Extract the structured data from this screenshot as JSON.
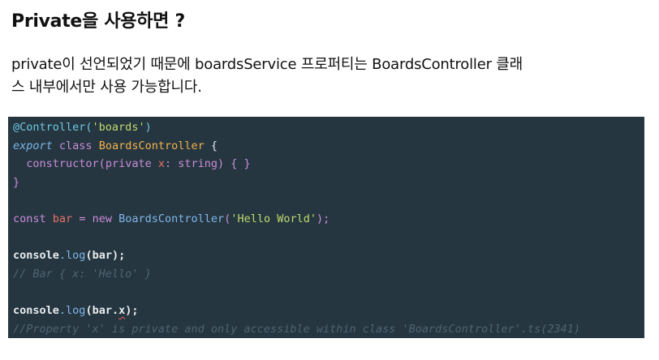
{
  "heading": "Private을 사용하면 ?",
  "paragraph": {
    "line1": "private이 선언되었기 때문에 boardsService 프로퍼티는 BoardsController 클래",
    "line2": "스 내부에서만 사용 가능합니다."
  },
  "code": {
    "l1": {
      "decorator": "@Controller(",
      "arg": "'boards'",
      "close": ")"
    },
    "l2": {
      "export": "export",
      "class": "class",
      "name": "BoardsController",
      "brace": "{"
    },
    "l3": {
      "ctor": "constructor",
      "open": "(",
      "private": "private",
      "param": "x",
      "type": ": string",
      "rest": ") { }"
    },
    "l4": {
      "brace": "}"
    },
    "l5": {
      "const": "const",
      "var": "bar",
      "eq": "=",
      "new": "new",
      "cls": "BoardsController",
      "open": "(",
      "str": "'Hello World'",
      "close": ");"
    },
    "l6": {
      "obj": "console",
      "dot": ".",
      "fn": "log",
      "args": "(bar);"
    },
    "l7": {
      "comment": "// Bar { x: 'Hello' }"
    },
    "l8": {
      "obj": "console",
      "dot": ".",
      "fn": "log",
      "args_a": "(bar.",
      "prop": "x",
      "args_b": ");"
    },
    "l9": {
      "comment": "//Property 'x' is private and only accessible within class 'BoardsController'.ts(2341)"
    }
  },
  "colors": {
    "code_background": "#263640",
    "string": "#bfd96e",
    "keyword": "#c98cd9",
    "class_name": "#f2b34c",
    "parameter": "#e57168",
    "function": "#7fb6ea",
    "comment": "#4e6470"
  }
}
